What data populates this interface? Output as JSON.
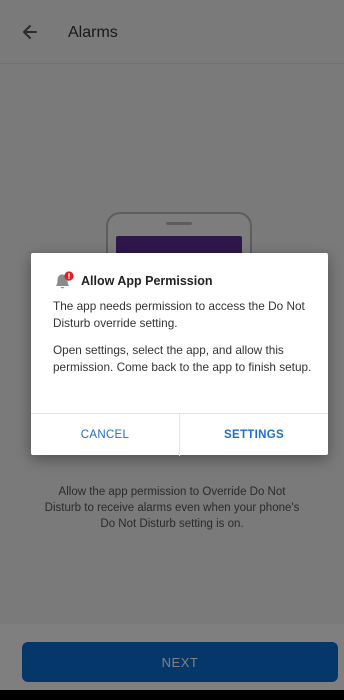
{
  "app_bar": {
    "title": "Alarms",
    "back_icon": "arrow-left-icon"
  },
  "content": {
    "description": "Allow the app permission to Override Do Not Disturb to receive alarms even when your phone's Do Not Disturb setting is on."
  },
  "footer": {
    "next_label": "NEXT"
  },
  "dialog": {
    "icon": "bell-alert-icon",
    "title": "Allow App Permission",
    "body_1": "The app needs permission to access the Do Not Disturb override setting.",
    "body_2": "Open settings, select the app, and allow this permission. Come back to the app to finish setup.",
    "cancel_label": "CANCEL",
    "settings_label": "SETTINGS"
  },
  "colors": {
    "primary": "#0b6fd6",
    "phone_screen": "#5d2f95",
    "badge": "#e02020",
    "dialog_button": "#1c6fc7"
  }
}
